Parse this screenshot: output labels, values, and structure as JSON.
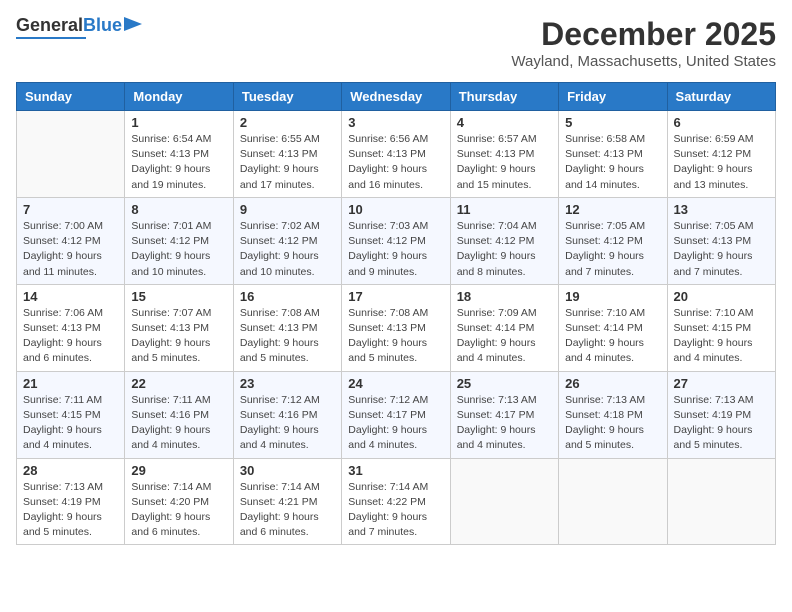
{
  "header": {
    "logo_line1": "General",
    "logo_line2": "Blue",
    "month": "December 2025",
    "location": "Wayland, Massachusetts, United States"
  },
  "weekdays": [
    "Sunday",
    "Monday",
    "Tuesday",
    "Wednesday",
    "Thursday",
    "Friday",
    "Saturday"
  ],
  "weeks": [
    [
      {
        "day": "",
        "info": ""
      },
      {
        "day": "1",
        "info": "Sunrise: 6:54 AM\nSunset: 4:13 PM\nDaylight: 9 hours\nand 19 minutes."
      },
      {
        "day": "2",
        "info": "Sunrise: 6:55 AM\nSunset: 4:13 PM\nDaylight: 9 hours\nand 17 minutes."
      },
      {
        "day": "3",
        "info": "Sunrise: 6:56 AM\nSunset: 4:13 PM\nDaylight: 9 hours\nand 16 minutes."
      },
      {
        "day": "4",
        "info": "Sunrise: 6:57 AM\nSunset: 4:13 PM\nDaylight: 9 hours\nand 15 minutes."
      },
      {
        "day": "5",
        "info": "Sunrise: 6:58 AM\nSunset: 4:13 PM\nDaylight: 9 hours\nand 14 minutes."
      },
      {
        "day": "6",
        "info": "Sunrise: 6:59 AM\nSunset: 4:12 PM\nDaylight: 9 hours\nand 13 minutes."
      }
    ],
    [
      {
        "day": "7",
        "info": "Sunrise: 7:00 AM\nSunset: 4:12 PM\nDaylight: 9 hours\nand 11 minutes."
      },
      {
        "day": "8",
        "info": "Sunrise: 7:01 AM\nSunset: 4:12 PM\nDaylight: 9 hours\nand 10 minutes."
      },
      {
        "day": "9",
        "info": "Sunrise: 7:02 AM\nSunset: 4:12 PM\nDaylight: 9 hours\nand 10 minutes."
      },
      {
        "day": "10",
        "info": "Sunrise: 7:03 AM\nSunset: 4:12 PM\nDaylight: 9 hours\nand 9 minutes."
      },
      {
        "day": "11",
        "info": "Sunrise: 7:04 AM\nSunset: 4:12 PM\nDaylight: 9 hours\nand 8 minutes."
      },
      {
        "day": "12",
        "info": "Sunrise: 7:05 AM\nSunset: 4:12 PM\nDaylight: 9 hours\nand 7 minutes."
      },
      {
        "day": "13",
        "info": "Sunrise: 7:05 AM\nSunset: 4:13 PM\nDaylight: 9 hours\nand 7 minutes."
      }
    ],
    [
      {
        "day": "14",
        "info": "Sunrise: 7:06 AM\nSunset: 4:13 PM\nDaylight: 9 hours\nand 6 minutes."
      },
      {
        "day": "15",
        "info": "Sunrise: 7:07 AM\nSunset: 4:13 PM\nDaylight: 9 hours\nand 5 minutes."
      },
      {
        "day": "16",
        "info": "Sunrise: 7:08 AM\nSunset: 4:13 PM\nDaylight: 9 hours\nand 5 minutes."
      },
      {
        "day": "17",
        "info": "Sunrise: 7:08 AM\nSunset: 4:13 PM\nDaylight: 9 hours\nand 5 minutes."
      },
      {
        "day": "18",
        "info": "Sunrise: 7:09 AM\nSunset: 4:14 PM\nDaylight: 9 hours\nand 4 minutes."
      },
      {
        "day": "19",
        "info": "Sunrise: 7:10 AM\nSunset: 4:14 PM\nDaylight: 9 hours\nand 4 minutes."
      },
      {
        "day": "20",
        "info": "Sunrise: 7:10 AM\nSunset: 4:15 PM\nDaylight: 9 hours\nand 4 minutes."
      }
    ],
    [
      {
        "day": "21",
        "info": "Sunrise: 7:11 AM\nSunset: 4:15 PM\nDaylight: 9 hours\nand 4 minutes."
      },
      {
        "day": "22",
        "info": "Sunrise: 7:11 AM\nSunset: 4:16 PM\nDaylight: 9 hours\nand 4 minutes."
      },
      {
        "day": "23",
        "info": "Sunrise: 7:12 AM\nSunset: 4:16 PM\nDaylight: 9 hours\nand 4 minutes."
      },
      {
        "day": "24",
        "info": "Sunrise: 7:12 AM\nSunset: 4:17 PM\nDaylight: 9 hours\nand 4 minutes."
      },
      {
        "day": "25",
        "info": "Sunrise: 7:13 AM\nSunset: 4:17 PM\nDaylight: 9 hours\nand 4 minutes."
      },
      {
        "day": "26",
        "info": "Sunrise: 7:13 AM\nSunset: 4:18 PM\nDaylight: 9 hours\nand 5 minutes."
      },
      {
        "day": "27",
        "info": "Sunrise: 7:13 AM\nSunset: 4:19 PM\nDaylight: 9 hours\nand 5 minutes."
      }
    ],
    [
      {
        "day": "28",
        "info": "Sunrise: 7:13 AM\nSunset: 4:19 PM\nDaylight: 9 hours\nand 5 minutes."
      },
      {
        "day": "29",
        "info": "Sunrise: 7:14 AM\nSunset: 4:20 PM\nDaylight: 9 hours\nand 6 minutes."
      },
      {
        "day": "30",
        "info": "Sunrise: 7:14 AM\nSunset: 4:21 PM\nDaylight: 9 hours\nand 6 minutes."
      },
      {
        "day": "31",
        "info": "Sunrise: 7:14 AM\nSunset: 4:22 PM\nDaylight: 9 hours\nand 7 minutes."
      },
      {
        "day": "",
        "info": ""
      },
      {
        "day": "",
        "info": ""
      },
      {
        "day": "",
        "info": ""
      }
    ]
  ]
}
